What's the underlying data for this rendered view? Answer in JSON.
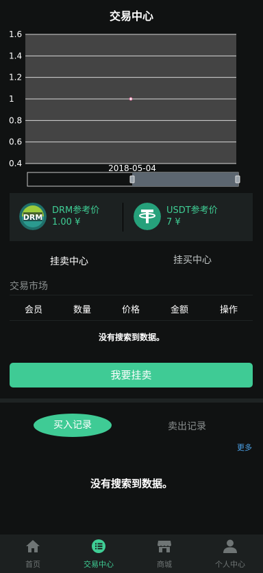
{
  "header": {
    "title": "交易中心"
  },
  "chart_data": {
    "type": "line",
    "x": [
      "2018-05-04"
    ],
    "series": [
      {
        "values": [
          1
        ]
      }
    ],
    "ylim": [
      0.4,
      1.6
    ],
    "yticks": [
      "1.6",
      "1.4",
      "1.2",
      "1",
      "0.8",
      "0.6",
      "0.4"
    ],
    "xlabel": "",
    "ylabel": "",
    "grid": true,
    "has_range_slider": true
  },
  "prices": {
    "drm": {
      "label": "DRM参考价",
      "value": "1.00 ¥",
      "logo_text": "DRM"
    },
    "usdt": {
      "label": "USDT参考价",
      "value": "7 ¥"
    }
  },
  "trade_tabs": {
    "sell": "挂卖中心",
    "buy": "挂买中心"
  },
  "market": {
    "title": "交易市场",
    "columns": [
      "会员",
      "数量",
      "价格",
      "金额",
      "操作"
    ],
    "empty_text": "没有搜索到数据。"
  },
  "sell_button": "我要挂卖",
  "records": {
    "tab_buy": "买入记录",
    "tab_sell": "卖出记录",
    "more": "更多",
    "empty_text": "没有搜索到数据。"
  },
  "nav": [
    {
      "label": "首页",
      "icon": "home-icon"
    },
    {
      "label": "交易中心",
      "icon": "trade-icon"
    },
    {
      "label": "商城",
      "icon": "shop-icon"
    },
    {
      "label": "个人中心",
      "icon": "user-icon"
    }
  ],
  "colors": {
    "accent": "#3fcb95",
    "link": "#4aa0e6",
    "background": "#101212",
    "plot_bg": "#444444"
  }
}
